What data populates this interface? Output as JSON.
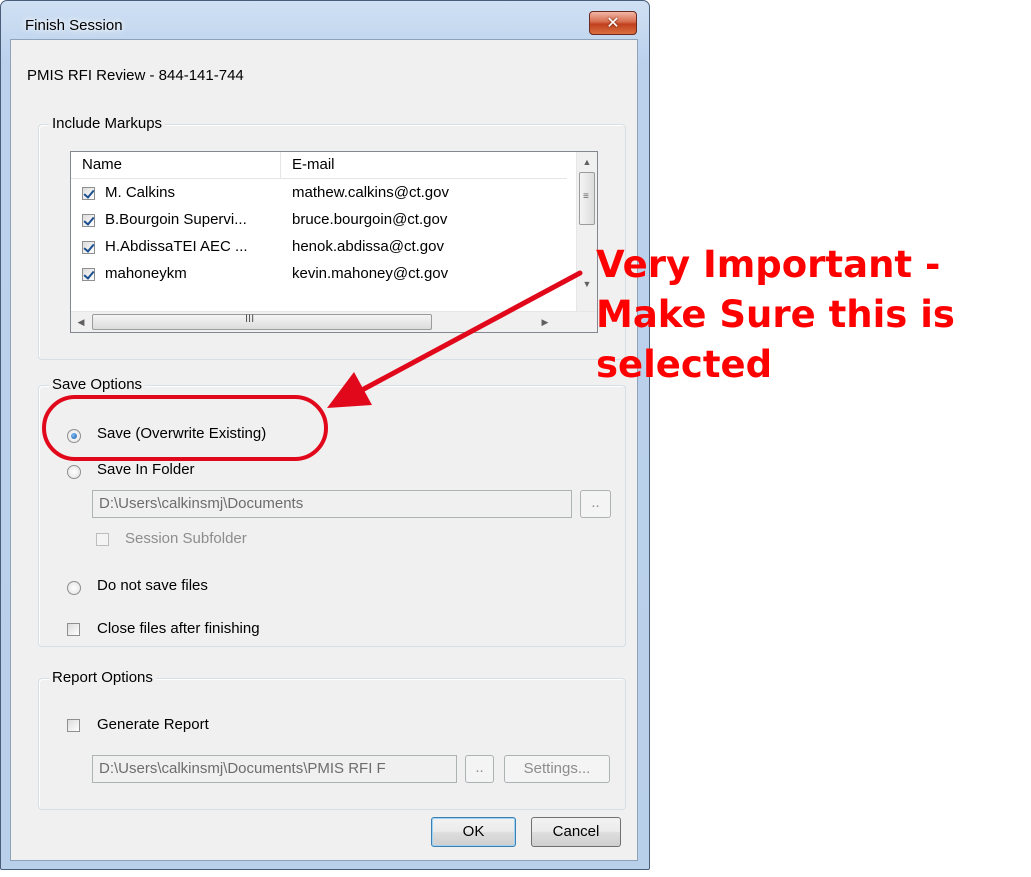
{
  "window": {
    "title": "Finish Session",
    "close_glyph": "✕",
    "session_name": "PMIS RFI Review - 844-141-744"
  },
  "markups": {
    "group_label": "Include Markups",
    "columns": [
      "Name",
      "E-mail"
    ],
    "rows": [
      {
        "name": "M. Calkins",
        "email": "mathew.calkins@ct.gov",
        "checked": true
      },
      {
        "name": "B.Bourgoin Supervi...",
        "email": "bruce.bourgoin@ct.gov",
        "checked": true
      },
      {
        "name": "H.AbdissaTEI AEC ...",
        "email": "henok.abdissa@ct.gov",
        "checked": true
      },
      {
        "name": "mahoneykm",
        "email": "kevin.mahoney@ct.gov",
        "checked": true
      }
    ],
    "scroll_up": "▲",
    "scroll_down": "▼",
    "scroll_left": "◀",
    "scroll_right": "▶",
    "vthumb_grip": "≡",
    "hthumb_grip": "III"
  },
  "save_options": {
    "group_label": "Save Options",
    "overwrite_label": "Save (Overwrite Existing)",
    "folder_label": "Save In Folder",
    "folder_path": "D:\\Users\\calkinsmj\\Documents",
    "browse_label": "..",
    "subfolder_label": "Session Subfolder",
    "do_not_save_label": "Do not save files",
    "close_files_label": "Close files after finishing",
    "selected": "overwrite"
  },
  "report_options": {
    "group_label": "Report Options",
    "generate_label": "Generate Report",
    "report_path": "D:\\Users\\calkinsmj\\Documents\\PMIS RFI F",
    "browse_label": "..",
    "settings_label": "Settings..."
  },
  "buttons": {
    "ok": "OK",
    "cancel": "Cancel"
  },
  "annotation": {
    "line1": "Very Important -",
    "line2": "Make Sure this is",
    "line3": "selected",
    "color": "#ff0000"
  }
}
